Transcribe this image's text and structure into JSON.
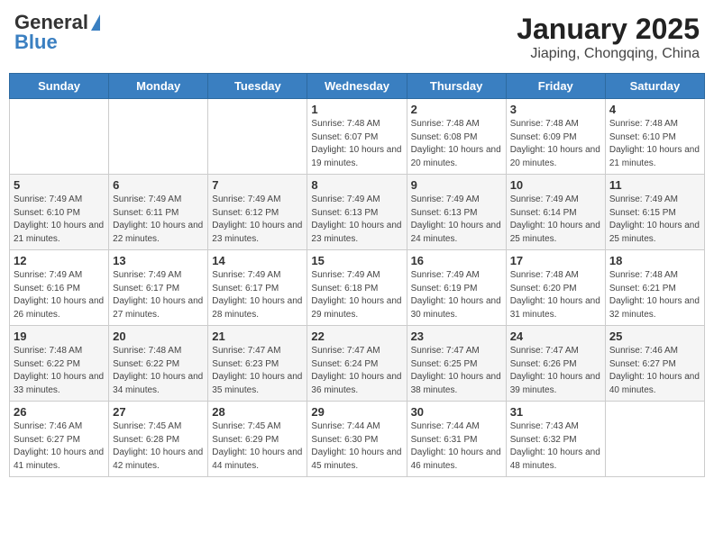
{
  "header": {
    "logo_general": "General",
    "logo_blue": "Blue",
    "title": "January 2025",
    "subtitle": "Jiaping, Chongqing, China"
  },
  "days_of_week": [
    "Sunday",
    "Monday",
    "Tuesday",
    "Wednesday",
    "Thursday",
    "Friday",
    "Saturday"
  ],
  "weeks": [
    [
      {
        "day": "",
        "info": ""
      },
      {
        "day": "",
        "info": ""
      },
      {
        "day": "",
        "info": ""
      },
      {
        "day": "1",
        "info": "Sunrise: 7:48 AM\nSunset: 6:07 PM\nDaylight: 10 hours and 19 minutes."
      },
      {
        "day": "2",
        "info": "Sunrise: 7:48 AM\nSunset: 6:08 PM\nDaylight: 10 hours and 20 minutes."
      },
      {
        "day": "3",
        "info": "Sunrise: 7:48 AM\nSunset: 6:09 PM\nDaylight: 10 hours and 20 minutes."
      },
      {
        "day": "4",
        "info": "Sunrise: 7:48 AM\nSunset: 6:10 PM\nDaylight: 10 hours and 21 minutes."
      }
    ],
    [
      {
        "day": "5",
        "info": "Sunrise: 7:49 AM\nSunset: 6:10 PM\nDaylight: 10 hours and 21 minutes."
      },
      {
        "day": "6",
        "info": "Sunrise: 7:49 AM\nSunset: 6:11 PM\nDaylight: 10 hours and 22 minutes."
      },
      {
        "day": "7",
        "info": "Sunrise: 7:49 AM\nSunset: 6:12 PM\nDaylight: 10 hours and 23 minutes."
      },
      {
        "day": "8",
        "info": "Sunrise: 7:49 AM\nSunset: 6:13 PM\nDaylight: 10 hours and 23 minutes."
      },
      {
        "day": "9",
        "info": "Sunrise: 7:49 AM\nSunset: 6:13 PM\nDaylight: 10 hours and 24 minutes."
      },
      {
        "day": "10",
        "info": "Sunrise: 7:49 AM\nSunset: 6:14 PM\nDaylight: 10 hours and 25 minutes."
      },
      {
        "day": "11",
        "info": "Sunrise: 7:49 AM\nSunset: 6:15 PM\nDaylight: 10 hours and 25 minutes."
      }
    ],
    [
      {
        "day": "12",
        "info": "Sunrise: 7:49 AM\nSunset: 6:16 PM\nDaylight: 10 hours and 26 minutes."
      },
      {
        "day": "13",
        "info": "Sunrise: 7:49 AM\nSunset: 6:17 PM\nDaylight: 10 hours and 27 minutes."
      },
      {
        "day": "14",
        "info": "Sunrise: 7:49 AM\nSunset: 6:17 PM\nDaylight: 10 hours and 28 minutes."
      },
      {
        "day": "15",
        "info": "Sunrise: 7:49 AM\nSunset: 6:18 PM\nDaylight: 10 hours and 29 minutes."
      },
      {
        "day": "16",
        "info": "Sunrise: 7:49 AM\nSunset: 6:19 PM\nDaylight: 10 hours and 30 minutes."
      },
      {
        "day": "17",
        "info": "Sunrise: 7:48 AM\nSunset: 6:20 PM\nDaylight: 10 hours and 31 minutes."
      },
      {
        "day": "18",
        "info": "Sunrise: 7:48 AM\nSunset: 6:21 PM\nDaylight: 10 hours and 32 minutes."
      }
    ],
    [
      {
        "day": "19",
        "info": "Sunrise: 7:48 AM\nSunset: 6:22 PM\nDaylight: 10 hours and 33 minutes."
      },
      {
        "day": "20",
        "info": "Sunrise: 7:48 AM\nSunset: 6:22 PM\nDaylight: 10 hours and 34 minutes."
      },
      {
        "day": "21",
        "info": "Sunrise: 7:47 AM\nSunset: 6:23 PM\nDaylight: 10 hours and 35 minutes."
      },
      {
        "day": "22",
        "info": "Sunrise: 7:47 AM\nSunset: 6:24 PM\nDaylight: 10 hours and 36 minutes."
      },
      {
        "day": "23",
        "info": "Sunrise: 7:47 AM\nSunset: 6:25 PM\nDaylight: 10 hours and 38 minutes."
      },
      {
        "day": "24",
        "info": "Sunrise: 7:47 AM\nSunset: 6:26 PM\nDaylight: 10 hours and 39 minutes."
      },
      {
        "day": "25",
        "info": "Sunrise: 7:46 AM\nSunset: 6:27 PM\nDaylight: 10 hours and 40 minutes."
      }
    ],
    [
      {
        "day": "26",
        "info": "Sunrise: 7:46 AM\nSunset: 6:27 PM\nDaylight: 10 hours and 41 minutes."
      },
      {
        "day": "27",
        "info": "Sunrise: 7:45 AM\nSunset: 6:28 PM\nDaylight: 10 hours and 42 minutes."
      },
      {
        "day": "28",
        "info": "Sunrise: 7:45 AM\nSunset: 6:29 PM\nDaylight: 10 hours and 44 minutes."
      },
      {
        "day": "29",
        "info": "Sunrise: 7:44 AM\nSunset: 6:30 PM\nDaylight: 10 hours and 45 minutes."
      },
      {
        "day": "30",
        "info": "Sunrise: 7:44 AM\nSunset: 6:31 PM\nDaylight: 10 hours and 46 minutes."
      },
      {
        "day": "31",
        "info": "Sunrise: 7:43 AM\nSunset: 6:32 PM\nDaylight: 10 hours and 48 minutes."
      },
      {
        "day": "",
        "info": ""
      }
    ]
  ]
}
